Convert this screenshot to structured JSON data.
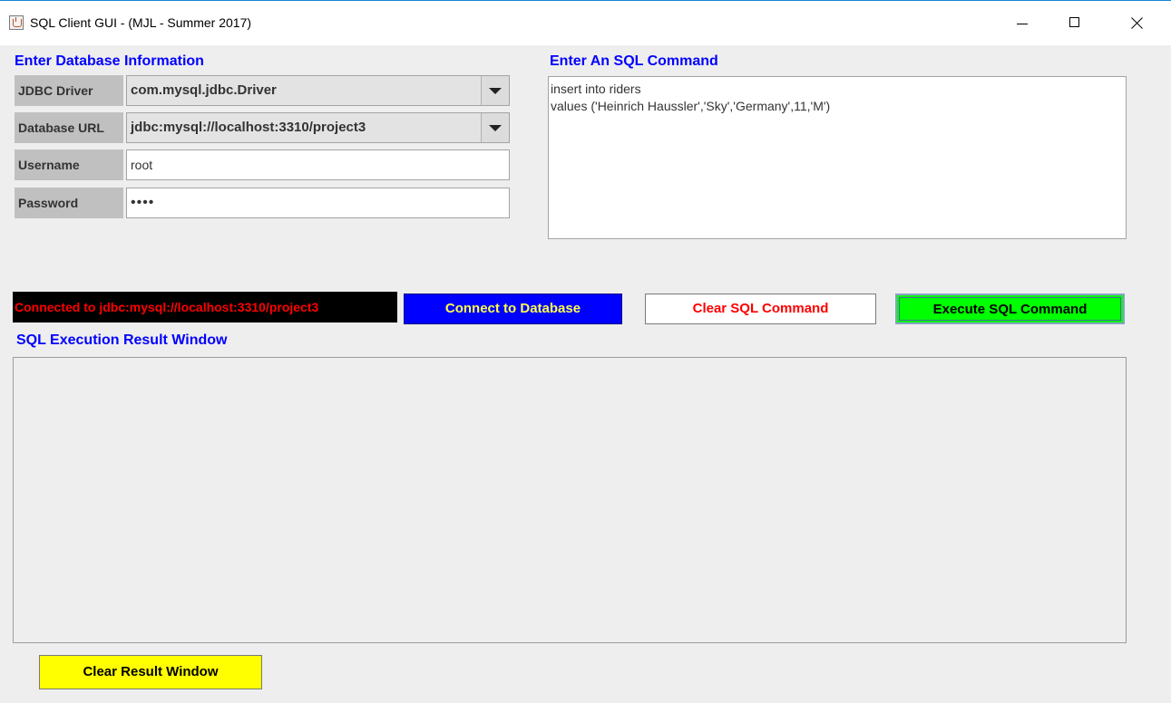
{
  "window": {
    "title": "SQL Client GUI - (MJL - Summer 2017)"
  },
  "db_info": {
    "section_title": "Enter Database Information",
    "jdbc_driver": {
      "label": "JDBC Driver",
      "value": "com.mysql.jdbc.Driver"
    },
    "database_url": {
      "label": "Database URL",
      "value": "jdbc:mysql://localhost:3310/project3"
    },
    "username": {
      "label": "Username",
      "value": "root"
    },
    "password": {
      "label": "Password",
      "value": "••••"
    }
  },
  "sql_command": {
    "section_title": "Enter An SQL Command",
    "text": "insert into riders\nvalues ('Heinrich Haussler','Sky','Germany',11,'M')"
  },
  "status": {
    "text": "Connected to jdbc:mysql://localhost:3310/project3",
    "color": "#ff0000",
    "background": "#000000"
  },
  "buttons": {
    "connect": "Connect to Database",
    "clear_sql": "Clear SQL Command",
    "execute": "Execute SQL Command",
    "clear_result": "Clear Result Window"
  },
  "results": {
    "section_title": "SQL Execution Result Window"
  },
  "colors": {
    "section_title": "#0000ff",
    "connect_bg": "#0000ff",
    "connect_fg": "#ffff44",
    "clear_sql_fg": "#ff0000",
    "execute_bg": "#00ff00",
    "clear_result_bg": "#ffff00"
  }
}
